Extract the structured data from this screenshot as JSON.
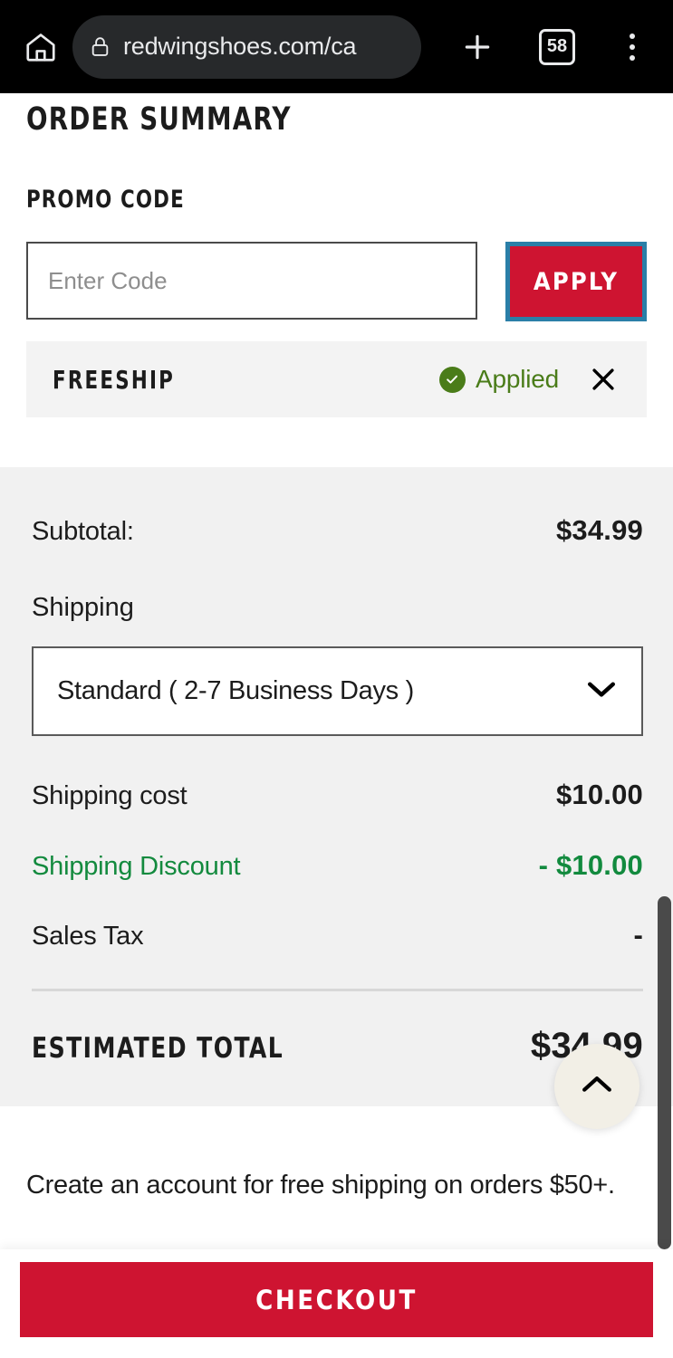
{
  "browser": {
    "home_icon": "home-icon",
    "lock_icon": "lock-icon",
    "url": "redwingshoes.com/ca",
    "new_tab_icon": "plus-icon",
    "tab_count": "58",
    "menu_icon": "kebab-menu-icon"
  },
  "page": {
    "title": "ORDER SUMMARY",
    "promo": {
      "label": "PROMO CODE",
      "input_value": "",
      "input_placeholder": "Enter Code",
      "apply_label": "APPLY",
      "apply_bg": "#CE1431",
      "apply_focus_ring": "#2A7FA8",
      "applied_code": "FREESHIP",
      "applied_status": "Applied",
      "applied_color": "#4A7C19",
      "check_icon": "check-circle-icon",
      "remove_icon": "close-x-icon"
    },
    "totals": {
      "subtotal_label": "Subtotal:",
      "subtotal_value": "$34.99",
      "shipping_label": "Shipping",
      "shipping_method": "Standard ( 2-7 Business Days )",
      "shipping_chevron_icon": "chevron-down-icon",
      "shipping_cost_label": "Shipping cost",
      "shipping_cost_value": "$10.00",
      "shipping_discount_label": "Shipping Discount",
      "shipping_discount_value": "- $10.00",
      "discount_color": "#128A3E",
      "sales_tax_label": "Sales Tax",
      "sales_tax_value": "-",
      "estimated_total_label": "ESTIMATED TOTAL",
      "estimated_total_value": "$34.99"
    },
    "account_note": "Create an account for free shipping on orders $50+.",
    "scroll_top_icon": "chevron-up-icon",
    "checkout_label": "CHECKOUT",
    "checkout_bg": "#CE1431"
  }
}
